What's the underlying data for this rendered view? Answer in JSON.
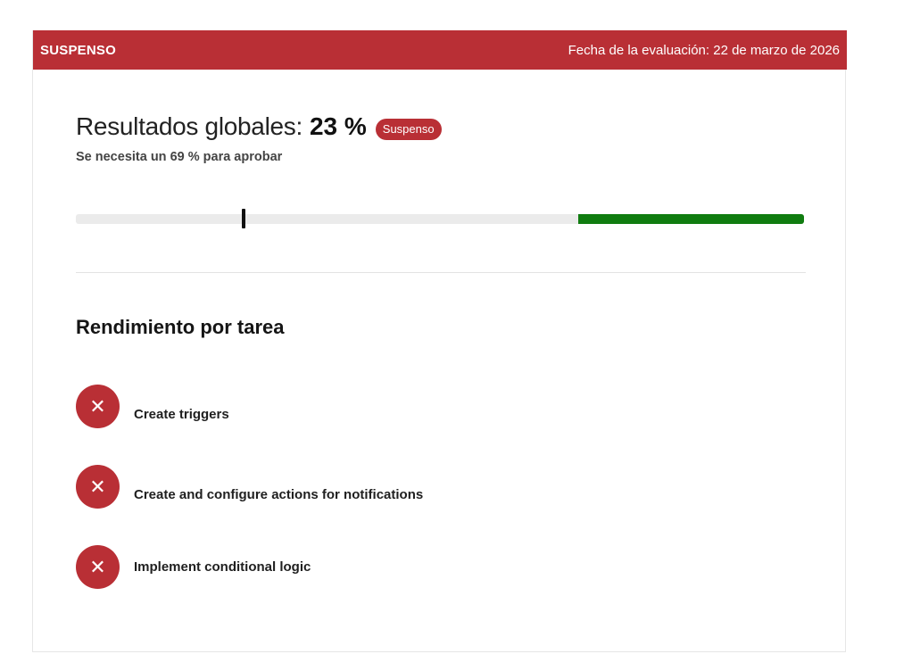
{
  "banner": {
    "status": "SUSPENSO",
    "date_text": "Fecha de la evaluación: 22 de marzo de 2026"
  },
  "result": {
    "label": "Resultados globales:",
    "score": "23 %",
    "badge": "Suspenso",
    "pass_requirement": "Se necesita un 69 % para aprobar",
    "score_fraction": 0.23,
    "pass_fraction": 0.69
  },
  "tasks_section": {
    "title": "Rendimiento por tarea",
    "items": [
      {
        "label": "Create triggers",
        "status": "failed",
        "icon": "close-icon"
      },
      {
        "label": "Create and configure actions for notifications",
        "status": "failed",
        "icon": "close-icon"
      },
      {
        "label": "Implement conditional logic",
        "status": "failed",
        "icon": "close-icon"
      }
    ]
  },
  "colors": {
    "fail": "#b92f35",
    "pass_zone": "#107c10",
    "track": "#ebebeb"
  }
}
